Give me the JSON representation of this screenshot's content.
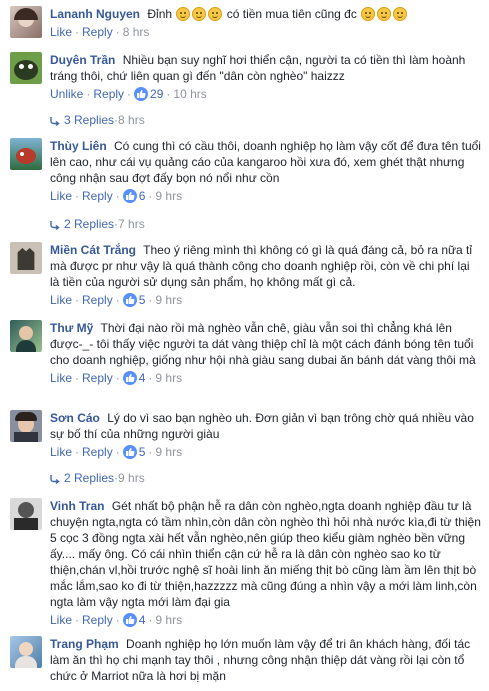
{
  "comments": [
    {
      "author": "Lananh Nguyen",
      "text_before": "Đỉnh",
      "text_after": "có tiền mua tiên cũng đc",
      "actions": {
        "like": "Like",
        "reply": "Reply",
        "time": "8 hrs"
      }
    },
    {
      "author": "Duyên Trần",
      "text": "Nhiều bạn suy nghĩ hơi thiển cận, người ta có tiền thì làm hoành tráng thôi, chứ liên quan gì đến \"dân còn nghèo\" haizzz",
      "actions": {
        "like": "Unlike",
        "reply": "Reply",
        "reactions": "29",
        "time": "10 hrs"
      },
      "replies": {
        "label": "3 Replies",
        "time": "8 hrs"
      }
    },
    {
      "author": "Thùy Liên",
      "text": "Có cung thì có cầu thôi, doanh nghiệp họ làm vậy cốt để đưa tên tuổi lên cao, như cái vụ quảng cáo của kangaroo hồi xưa đó, xem ghét thật nhưng công nhận sau đợt đấy bọn nó nổi như cồn",
      "actions": {
        "like": "Like",
        "reply": "Reply",
        "reactions": "6",
        "time": "9 hrs"
      },
      "replies": {
        "label": "2 Replies",
        "time": "7 hrs"
      }
    },
    {
      "author": "Miền Cát Trắng",
      "text": "Theo ý riêng mình thì không có gì là quá đáng cả, bỏ ra nữa tỉ mà được pr như vậy là quá thành công cho doanh nghiệp rồi, còn về chi phí lại là tiền của người sử dụng sản phẩm, họ không mất gì cả.",
      "actions": {
        "like": "Like",
        "reply": "Reply",
        "reactions": "5",
        "time": "9 hrs"
      }
    },
    {
      "author": "Thư Mỹ",
      "text": "Thời đại nào rồi mà nghèo vẫn chê, giàu vẫn soi thì chẳng khá lên được-_- tôi thấy việc người ta dát vàng thiệp chỉ là một cách đánh bóng tên tuổi cho doanh nghiệp, giống như hội nhà giàu sang dubai ăn bánh dát vàng thôi mà",
      "actions": {
        "like": "Like",
        "reply": "Reply",
        "reactions": "4",
        "time": "9 hrs"
      }
    },
    {
      "author": "Sơn Cáo",
      "text": "Lý do vì sao bạn nghèo uh. Đơn giản vì bạn trông chờ quá nhiều vào sự bố thí của những người giàu",
      "actions": {
        "like": "Like",
        "reply": "Reply",
        "reactions": "5",
        "time": "9 hrs"
      },
      "replies": {
        "label": "2 Replies",
        "time": "9 hrs"
      }
    },
    {
      "author": "Vinh Tran",
      "text": "Gét nhất bộ phận hễ ra dân còn nghèo,ngta doanh nghiệp đầu tư là chuyện ngta,ngta có tầm nhìn,còn dân còn nghèo thì hỏi nhà nước kìa,đi từ thiện 5 cọc 3 đồng ngta xài hết vẫn nghèo,nên giúp theo kiểu giàm nghèo bền vững ấy.... mấy ông. Có cái nhìn thiển cận cứ hễ ra là dân còn nghèo sao ko từ thiện,chán vl,hồi trước nghệ sĩ hoài linh ăn miếng thịt bò cũng làm ầm lên thịt bò mắc lắm,sao ko đi từ thiện,hazzzzz mà cũng đúng a nhìn vậy a mới làm linh,còn ngta làm vậy ngta mới làm đại gia",
      "actions": {
        "like": "Like",
        "reply": "Reply",
        "reactions": "4",
        "time": "9 hrs"
      }
    },
    {
      "author": "Trang Phạm",
      "text": "Doanh nghiệp họ lớn muốn làm vậy để tri ân khách hàng, đối tác làm ăn thì họ chi mạnh tay thôi , nhưng công nhận thiệp dát vàng rồi lại còn tổ chức ở Marriot nữa là hơi bị mặn"
    }
  ],
  "colors": {
    "author": "#365899",
    "link": "#4267b2",
    "meta": "#90949c",
    "like_badge": "#5890ff"
  }
}
